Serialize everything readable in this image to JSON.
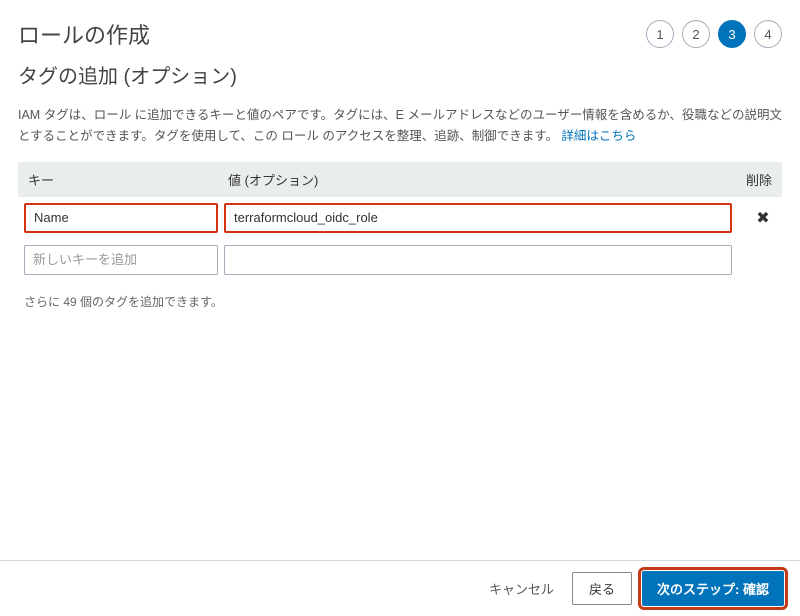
{
  "header": {
    "title": "ロールの作成",
    "steps": [
      "1",
      "2",
      "3",
      "4"
    ],
    "active_step_index": 2
  },
  "subtitle": "タグの追加 (オプション)",
  "description": {
    "text_before": "IAM タグは、ロール に追加できるキーと値のペアです。タグには、E メールアドレスなどのユーザー情報を含めるか、役職などの説明文とすることができます。タグを使用して、この ロール のアクセスを整理、追跡、制御できます。 ",
    "link_text": "詳細はこちら"
  },
  "table": {
    "head": {
      "key": "キー",
      "value": "値 (オプション)",
      "delete": "削除"
    },
    "rows": [
      {
        "key": "Name",
        "value": "terraformcloud_oidc_role",
        "deletable": true
      }
    ],
    "new_key_placeholder": "新しいキーを追加"
  },
  "limit": {
    "prefix": "さらに ",
    "count": "49",
    "suffix": " 個のタグを追加できます。"
  },
  "footer": {
    "cancel": "キャンセル",
    "back": "戻る",
    "next": "次のステップ: 確認"
  }
}
